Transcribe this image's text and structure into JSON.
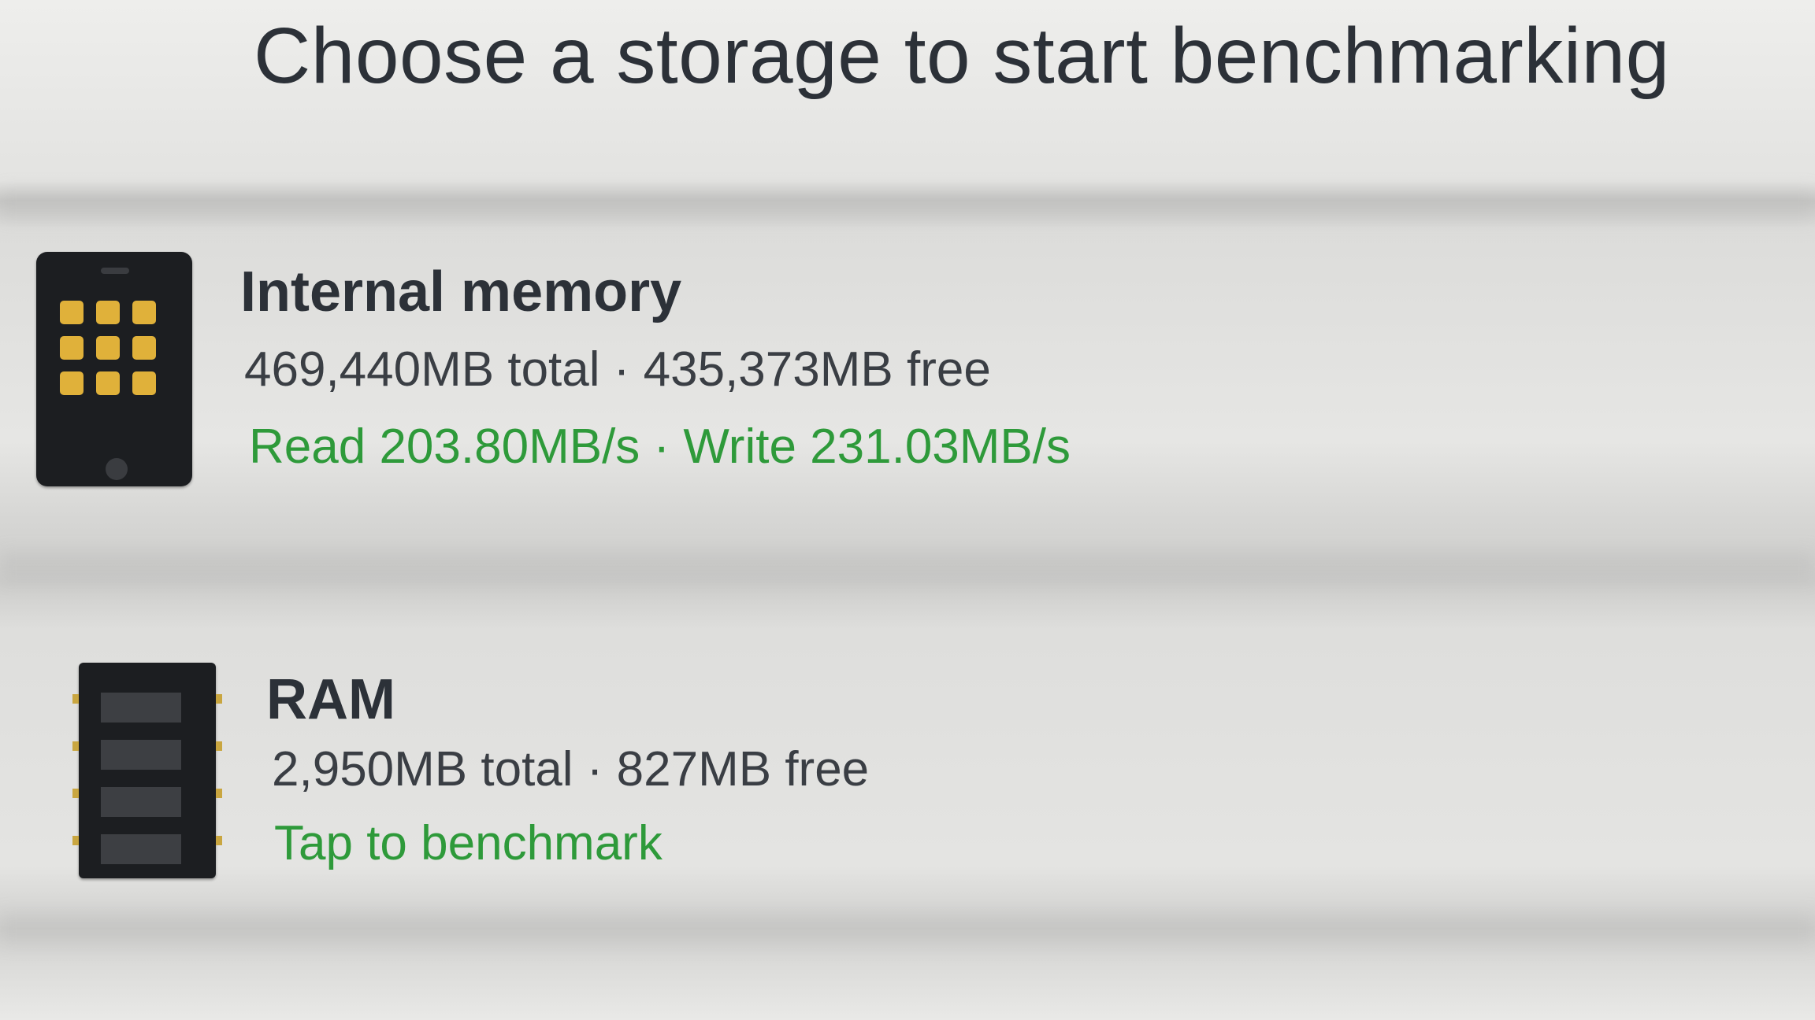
{
  "header": {
    "title": "Choose a storage to start benchmarking"
  },
  "storages": [
    {
      "name": "Internal memory",
      "icon": "phone-icon",
      "capacity": "469,440MB total · 435,373MB free",
      "status": "Read 203.80MB/s · Write 231.03MB/s"
    },
    {
      "name": "RAM",
      "icon": "memory-chip-icon",
      "capacity": "2,950MB total · 827MB free",
      "status": "Tap to benchmark"
    }
  ],
  "colors": {
    "status_text": "#2e9a3a",
    "primary_text": "#2c3138",
    "icon_body": "#1c1e21",
    "icon_accent": "#e0b13a"
  }
}
